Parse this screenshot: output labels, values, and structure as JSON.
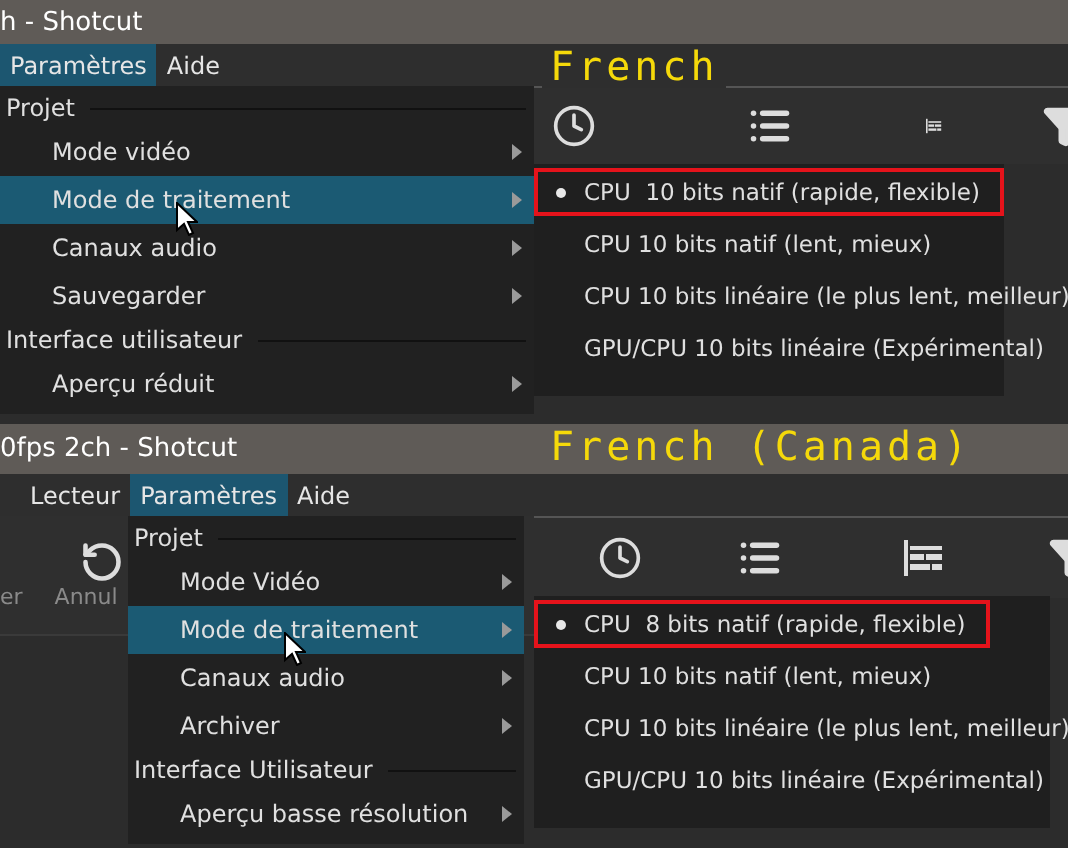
{
  "panels": [
    {
      "title": "h - Shotcut",
      "language_label": "French",
      "menubar": [
        {
          "label": "Paramètres",
          "selected": true
        },
        {
          "label": "Aide",
          "selected": false
        }
      ],
      "menu": [
        {
          "kind": "header",
          "label": "Projet"
        },
        {
          "kind": "item",
          "label": "Mode vidéo",
          "selected": false
        },
        {
          "kind": "item",
          "label": "Mode de traitement",
          "selected": true
        },
        {
          "kind": "item",
          "label": "Canaux audio",
          "selected": false
        },
        {
          "kind": "item",
          "label": "Sauvegarder",
          "selected": false
        },
        {
          "kind": "header",
          "label": "Interface utilisateur"
        },
        {
          "kind": "item",
          "label": "Aperçu réduit",
          "selected": false
        }
      ],
      "submenu": [
        {
          "label": "CPU  10 bits natif (rapide, flexible)",
          "checked": true,
          "boxed": true
        },
        {
          "label": "CPU 10 bits natif (lent, mieux)",
          "checked": false,
          "boxed": false
        },
        {
          "label": "CPU 10 bits linéaire (le plus lent, meilleur)",
          "checked": false,
          "boxed": false
        },
        {
          "label": "GPU/CPU 10 bits linéaire (Expérimental)",
          "checked": false,
          "boxed": false
        }
      ]
    },
    {
      "title": "0fps 2ch - Shotcut",
      "language_label": "French (Canada)",
      "menubar": [
        {
          "label": "Lecteur",
          "selected": false
        },
        {
          "label": "Paramètres",
          "selected": true
        },
        {
          "label": "Aide",
          "selected": false
        }
      ],
      "toolbar_buttons": [
        "er",
        "Annul"
      ],
      "menu": [
        {
          "kind": "header",
          "label": "Projet"
        },
        {
          "kind": "item",
          "label": "Mode Vidéo",
          "selected": false
        },
        {
          "kind": "item",
          "label": "Mode de traitement",
          "selected": true
        },
        {
          "kind": "item",
          "label": "Canaux audio",
          "selected": false
        },
        {
          "kind": "item",
          "label": "Archiver",
          "selected": false
        },
        {
          "kind": "header",
          "label": "Interface Utilisateur"
        },
        {
          "kind": "item",
          "label": "Aperçu basse résolution",
          "selected": false
        }
      ],
      "submenu": [
        {
          "label": "CPU  8 bits natif (rapide, flexible)",
          "checked": true,
          "boxed": true
        },
        {
          "label": "CPU 10 bits natif (lent, mieux)",
          "checked": false,
          "boxed": false
        },
        {
          "label": "CPU 10 bits linéaire (le plus lent, meilleur)",
          "checked": false,
          "boxed": false
        },
        {
          "label": "GPU/CPU 10 bits linéaire (Expérimental)",
          "checked": false,
          "boxed": false
        }
      ]
    }
  ]
}
